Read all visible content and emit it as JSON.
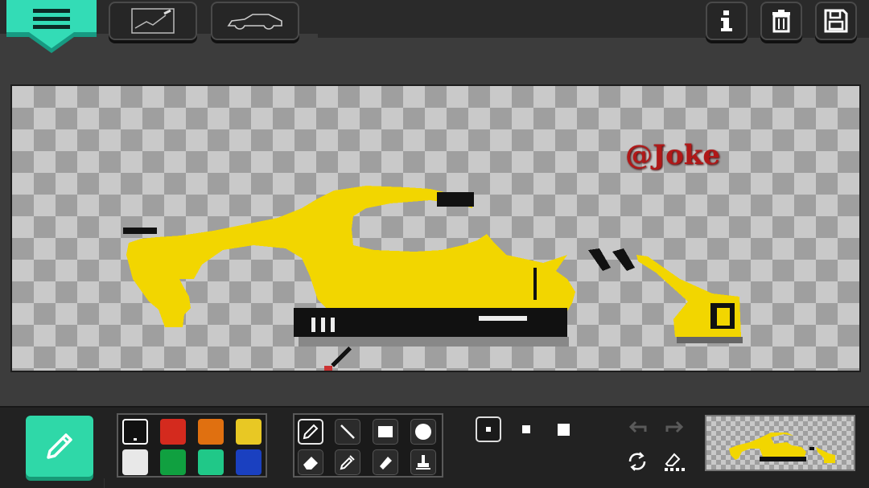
{
  "toolbar": {
    "menu_icon": "hamburger-icon",
    "tabs": [
      {
        "name": "sketch-tab",
        "icon": "sketch-icon"
      },
      {
        "name": "car-outline-tab",
        "icon": "car-silhouette-icon"
      }
    ],
    "actions": [
      {
        "name": "info-button",
        "icon": "info-icon"
      },
      {
        "name": "delete-button",
        "icon": "trash-icon"
      },
      {
        "name": "save-button",
        "icon": "floppy-disk-icon"
      }
    ]
  },
  "canvas": {
    "watermark": "@Joke",
    "paint_color": "#f2d600"
  },
  "palette": {
    "colors": [
      "#111111",
      "#d42a1e",
      "#e07010",
      "#e8c824",
      "#e8e8e8",
      "#10a040",
      "#20c888",
      "#1a40c0"
    ],
    "selected_index": 0
  },
  "tools": {
    "items": [
      "pencil-icon",
      "line-icon",
      "rectangle-icon",
      "circle-icon",
      "eraser-icon",
      "eyedropper-icon",
      "fill-bucket-icon",
      "stamp-icon"
    ],
    "selected_index": 0
  },
  "brush_sizes": {
    "options": [
      "small",
      "medium",
      "large"
    ],
    "selected_index": 0
  },
  "history": {
    "undo_enabled": false,
    "redo_enabled": false
  }
}
